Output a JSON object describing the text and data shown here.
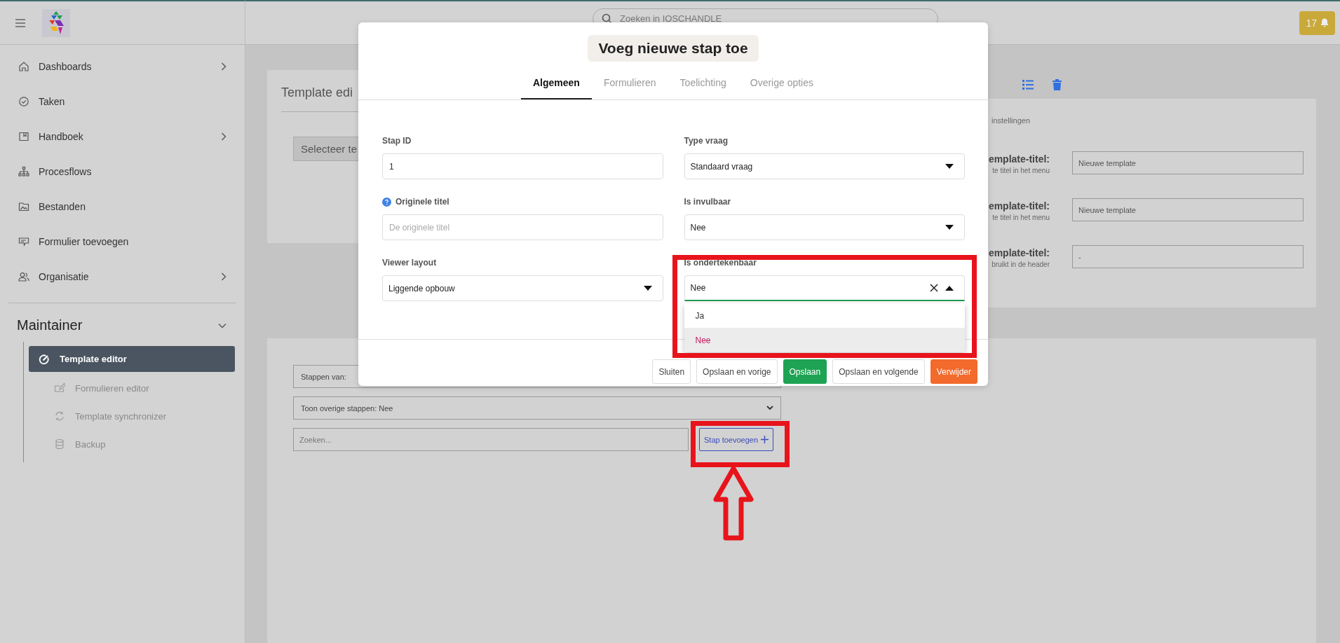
{
  "topbar": {
    "search_placeholder": "Zoeken in IOSCHANDLE",
    "notifications": "17"
  },
  "sidebar": {
    "items": [
      {
        "label": "Dashboards",
        "has_submenu": true
      },
      {
        "label": "Taken",
        "has_submenu": false
      },
      {
        "label": "Handboek",
        "has_submenu": true
      },
      {
        "label": "Procesflows",
        "has_submenu": false
      },
      {
        "label": "Bestanden",
        "has_submenu": false
      },
      {
        "label": "Formulier toevoegen",
        "has_submenu": false
      },
      {
        "label": "Organisatie",
        "has_submenu": true
      }
    ],
    "section": {
      "title": "Maintainer",
      "expanded": true,
      "items": [
        {
          "label": "Template editor",
          "selected": true
        },
        {
          "label": "Formulieren editor",
          "selected": false
        },
        {
          "label": "Template synchronizer",
          "selected": false
        },
        {
          "label": "Backup",
          "selected": false
        }
      ]
    }
  },
  "editor_card": {
    "title": "Template edi",
    "select": "Selecteer te"
  },
  "settings_card": {
    "heading": "instellingen",
    "rows": [
      {
        "label": "emplate-titel:",
        "hint": "te titel in het menu",
        "value": "Nieuwe template"
      },
      {
        "label": "emplate-titel:",
        "hint": "te titel in het menu",
        "value": "Nieuwe template"
      },
      {
        "label": "emplate-titel:",
        "hint": "bruikt in de header",
        "value": "-"
      }
    ]
  },
  "steps_card": {
    "steps_select": "Stappen van:",
    "show_select": "Toon overige stappen: Nee",
    "search_placeholder": "Zoeken...",
    "add_button": "Stap toevoegen"
  },
  "modal": {
    "title": "Voeg nieuwe stap toe",
    "tabs": [
      {
        "label": "Algemeen",
        "selected": true
      },
      {
        "label": "Formulieren",
        "selected": false
      },
      {
        "label": "Toelichting",
        "selected": false
      },
      {
        "label": "Overige opties",
        "selected": false
      }
    ],
    "fields": [
      {
        "kind": "input",
        "label": "Stap ID",
        "value": "1",
        "help": false
      },
      {
        "kind": "select",
        "label": "Type vraag",
        "value": "Standaard vraag",
        "expanded": false,
        "help": false
      },
      {
        "kind": "input",
        "label": "Originele titel",
        "placeholder": "De originele titel",
        "help": true
      },
      {
        "kind": "select",
        "label": "Is invulbaar",
        "value": "Nee",
        "expanded": false,
        "help": false
      },
      {
        "kind": "select",
        "label": "Viewer layout",
        "value": "Liggende opbouw",
        "expanded": false,
        "help": false
      },
      {
        "kind": "select",
        "label": "Is ondertekenbaar",
        "value": "Nee",
        "expanded": true,
        "help": false,
        "options": [
          {
            "label": "Ja",
            "selected": false
          },
          {
            "label": "Nee",
            "selected": true
          }
        ]
      }
    ],
    "buttons": [
      {
        "label": "Sluiten",
        "kind": "outline"
      },
      {
        "label": "Opslaan en vorige",
        "kind": "outline"
      },
      {
        "label": "Opslaan",
        "kind": "primary"
      },
      {
        "label": "Opslaan en volgende",
        "kind": "outline"
      },
      {
        "label": "Verwijder",
        "kind": "danger"
      }
    ]
  },
  "annotations": [
    {
      "kind": "frame"
    },
    {
      "kind": "frame"
    },
    {
      "kind": "arrow"
    }
  ]
}
